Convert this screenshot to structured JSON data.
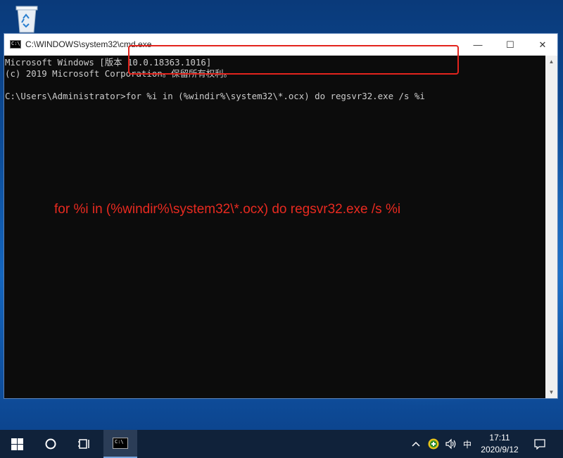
{
  "window": {
    "title": "C:\\WINDOWS\\system32\\cmd.exe",
    "icon_label": "C:\\",
    "minimize_glyph": "—",
    "maximize_glyph": "☐",
    "close_glyph": "✕"
  },
  "console": {
    "lines": [
      "Microsoft Windows [版本 10.0.18363.1016]",
      "(c) 2019 Microsoft Corporation。保留所有权利。",
      "",
      "C:\\Users\\Administrator>for %i in (%windir%\\system32\\*.ocx) do regsvr32.exe /s %i"
    ]
  },
  "annotation": {
    "text": "for %i in (%windir%\\system32\\*.ocx) do regsvr32.exe /s %i",
    "color": "#e82a20"
  },
  "colors": {
    "highlight_border": "#e3241d",
    "console_bg": "#0c0c0c",
    "console_text": "#cccccc",
    "taskbar_bg": "#10223a"
  },
  "taskbar": {
    "ime_label": "中",
    "time": "17:11",
    "date": "2020/9/12",
    "cmd_icon_label": "C:\\"
  },
  "icons": {
    "recycle_bin": "recycle-bin-icon",
    "start": "windows-start-icon",
    "search": "cortana-circle-icon",
    "task_view": "task-view-icon",
    "chevron": "chevron-up-icon",
    "network": "network-status-icon",
    "volume": "speaker-icon",
    "notification": "action-center-icon"
  }
}
